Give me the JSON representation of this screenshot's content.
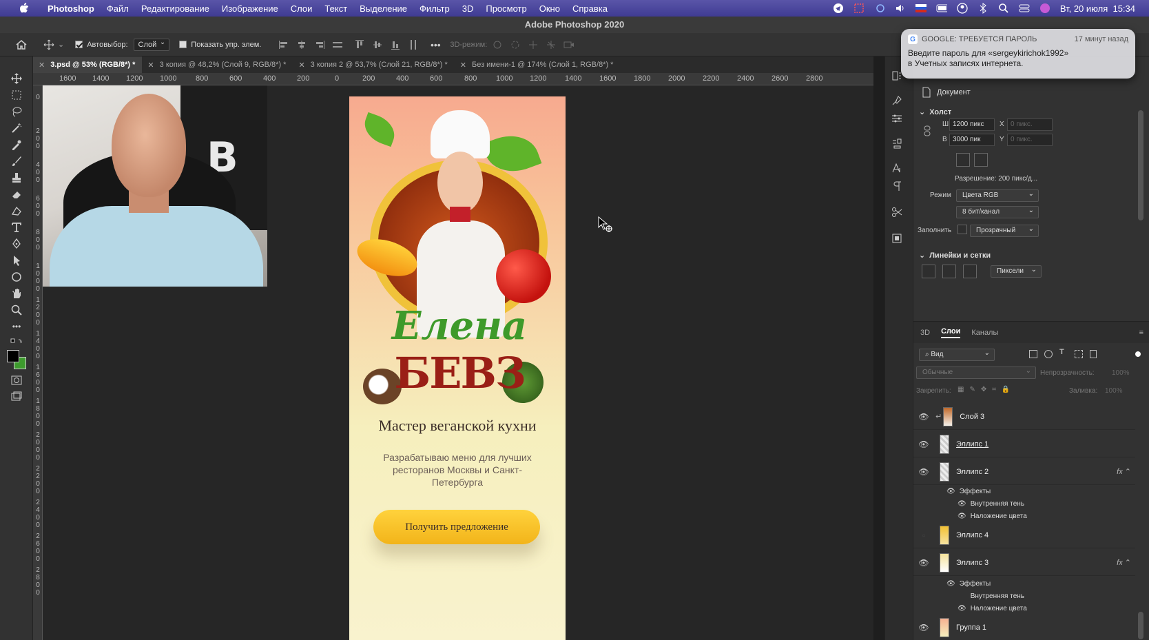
{
  "menubar": {
    "app_name": "Photoshop",
    "items": [
      "Файл",
      "Редактирование",
      "Изображение",
      "Слои",
      "Текст",
      "Выделение",
      "Фильтр",
      "3D",
      "Просмотр",
      "Окно",
      "Справка"
    ],
    "datetime": "Вт, 20 июля  15:34"
  },
  "window_title": "Adobe Photoshop 2020",
  "options_bar": {
    "autoselect_label": "Автовыбор:",
    "autoselect_value": "Слой",
    "show_transform_label": "Показать упр. элем.",
    "mode_3d_label": "3D-режим:"
  },
  "tabs": [
    {
      "label": "3.psd @ 53% (RGB/8*) *",
      "active": true
    },
    {
      "label": "3 копия @ 48,2% (Слой 9, RGB/8*) *",
      "active": false
    },
    {
      "label": "3 копия 2 @ 53,7% (Слой 21, RGB/8*) *",
      "active": false
    },
    {
      "label": "Без имени-1 @ 174% (Слой 1, RGB/8*) *",
      "active": false
    }
  ],
  "ruler_top_labels": [
    "1600",
    "1400",
    "1200",
    "1000",
    "800",
    "600",
    "400",
    "200",
    "0",
    "200",
    "400",
    "600",
    "800",
    "1000",
    "1200",
    "1400",
    "1600",
    "1800",
    "2000",
    "2200",
    "2400",
    "2600",
    "2800"
  ],
  "ruler_left_labels": [
    "0",
    "2 0 0",
    "4 0 0",
    "6 0 0",
    "8 0 0",
    "1 0 0 0",
    "1 2 0 0",
    "1 4 0 0",
    "1 6 0 0",
    "1 8 0 0",
    "2 0 0 0",
    "2 2 0 0",
    "2 4 0 0",
    "2 6 0 0",
    "2 8 0 0"
  ],
  "poster": {
    "name_line1": "Елена",
    "name_line2": "БЕВЗ",
    "subtitle": "Мастер веганской кухни",
    "description": "Разрабатываю меню для лучших ресторанов Москвы и Санкт-Петербурга",
    "cta": "Получить предложение"
  },
  "notification": {
    "source": "GOOGLE: ТРЕБУЕТСЯ ПАРОЛЬ",
    "time": "17 минут назад",
    "line1": "Введите пароль для «sergeykirichok1992»",
    "line2": "в Учетных записях интернета."
  },
  "properties": {
    "document_label": "Документ",
    "canvas_section": "Холст",
    "width_label": "Ш",
    "width_value": "1200 пикс",
    "height_label": "В",
    "height_value": "3000 пик",
    "x_label": "X",
    "x_placeholder": "0 пикс.",
    "y_label": "Y",
    "y_placeholder": "0 пикс.",
    "resolution": "Разрешение: 200 пикс/д...",
    "mode_label": "Режим",
    "mode_value": "Цвета RGB",
    "depth_value": "8 бит/канал",
    "fill_label": "Заполнить",
    "fill_value": "Прозрачный",
    "rulers_section": "Линейки и сетки",
    "units_value": "Пиксели"
  },
  "layers_panel": {
    "tabs": [
      "3D",
      "Слои",
      "Каналы"
    ],
    "active_tab": "Слои",
    "filter_label": "Вид",
    "blend_mode": "Обычные",
    "opacity_label": "Непрозрачность:",
    "opacity_value": "100%",
    "lock_label": "Закрепить:",
    "fill_label": "Заливка:",
    "fill_value": "100%",
    "effects_label": "Эффекты",
    "layers": [
      {
        "name": "Слой 3",
        "visible": true,
        "fx": false
      },
      {
        "name": "Эллипс 1",
        "visible": true,
        "fx": false
      },
      {
        "name": "Эллипс 2",
        "visible": true,
        "fx": true,
        "effects": [
          "Внутренняя тень",
          "Наложение цвета"
        ]
      },
      {
        "name": "Эллипс 4",
        "visible": false,
        "fx": false
      },
      {
        "name": "Эллипс 3",
        "visible": true,
        "fx": true,
        "effects": [
          "Внутренняя тень",
          "Наложение цвета"
        ]
      },
      {
        "name": "Группа 1",
        "visible": true,
        "fx": false
      }
    ]
  },
  "colors": {
    "menubar": "#4a46a0",
    "workspace": "#262626",
    "panel": "#323232",
    "poster_cta": "#f5c02a",
    "poster_name_green": "#3e9a2a",
    "poster_name_red": "#9a1f16"
  }
}
